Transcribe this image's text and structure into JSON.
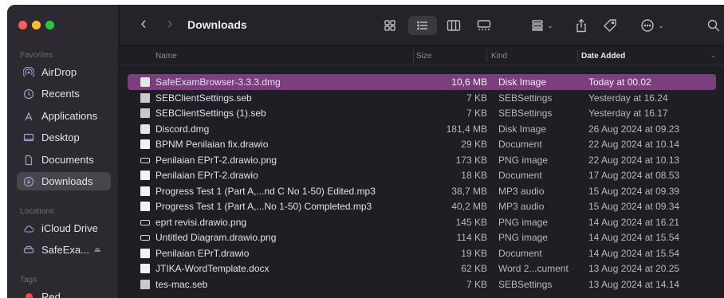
{
  "sidebar": {
    "favorites_label": "Favorites",
    "items": [
      {
        "label": "AirDrop",
        "icon": "airdrop-icon"
      },
      {
        "label": "Recents",
        "icon": "clock-icon"
      },
      {
        "label": "Applications",
        "icon": "applications-icon"
      },
      {
        "label": "Desktop",
        "icon": "desktop-icon"
      },
      {
        "label": "Documents",
        "icon": "document-icon"
      },
      {
        "label": "Downloads",
        "icon": "download-icon",
        "active": true
      }
    ],
    "locations_label": "Locations",
    "locations": [
      {
        "label": "iCloud Drive",
        "icon": "cloud-icon"
      },
      {
        "label": "SafeExa...",
        "icon": "drive-icon",
        "eject": "⏏"
      }
    ],
    "tags_label": "Tags",
    "tags": [
      {
        "label": "Red",
        "color": "#ff453a"
      }
    ]
  },
  "toolbar": {
    "title": "Downloads",
    "back": "‹",
    "forward": "›"
  },
  "columns": {
    "name": "Name",
    "size": "Size",
    "kind": "Kind",
    "date": "Date Added"
  },
  "files": [
    {
      "name": "SafeExamBrowser-3.3.3.dmg",
      "size": "10,6 MB",
      "kind": "Disk Image",
      "date": "Today at 00.02",
      "type": "dmg",
      "selected": true
    },
    {
      "name": "SEBClientSettings.seb",
      "size": "7 KB",
      "kind": "SEBSettings",
      "date": "Yesterday at 16.24",
      "type": "seb"
    },
    {
      "name": "SEBClientSettings (1).seb",
      "size": "7 KB",
      "kind": "SEBSettings",
      "date": "Yesterday at 16.17",
      "type": "seb"
    },
    {
      "name": "Discord.dmg",
      "size": "181,4 MB",
      "kind": "Disk Image",
      "date": "26 Aug 2024 at 09.23",
      "type": "dmg"
    },
    {
      "name": "BPNM Penilaian fix.drawio",
      "size": "29 KB",
      "kind": "Document",
      "date": "22 Aug 2024 at 10.14",
      "type": "doc"
    },
    {
      "name": "Penilaian EPrT-2.drawio.png",
      "size": "173 KB",
      "kind": "PNG image",
      "date": "22 Aug 2024 at 10.13",
      "type": "img"
    },
    {
      "name": "Penilaian EPrT-2.drawio",
      "size": "18 KB",
      "kind": "Document",
      "date": "17 Aug 2024 at 08.53",
      "type": "doc"
    },
    {
      "name": "Progress Test 1 (Part A,...nd C No 1-50) Edited.mp3",
      "size": "38,7 MB",
      "kind": "MP3 audio",
      "date": "15 Aug 2024 at 09.39",
      "type": "doc"
    },
    {
      "name": "Progress Test 1 (Part A,...No 1-50) Completed.mp3",
      "size": "40,2 MB",
      "kind": "MP3 audio",
      "date": "15 Aug 2024 at 09.34",
      "type": "doc"
    },
    {
      "name": "eprt revisi.drawio.png",
      "size": "145 KB",
      "kind": "PNG image",
      "date": "14 Aug 2024 at 16.21",
      "type": "img"
    },
    {
      "name": "Untitled Diagram.drawio.png",
      "size": "114 KB",
      "kind": "PNG image",
      "date": "14 Aug 2024 at 15.54",
      "type": "img"
    },
    {
      "name": "Penilaian EPrT.drawio",
      "size": "19 KB",
      "kind": "Document",
      "date": "14 Aug 2024 at 15.54",
      "type": "doc"
    },
    {
      "name": "JTIKA-WordTemplate.docx",
      "size": "62 KB",
      "kind": "Word 2...cument",
      "date": "13 Aug 2024 at 20.25",
      "type": "doc"
    },
    {
      "name": "tes-mac.seb",
      "size": "7 KB",
      "kind": "SEBSettings",
      "date": "13 Aug 2024 at 14.14",
      "type": "seb"
    }
  ]
}
